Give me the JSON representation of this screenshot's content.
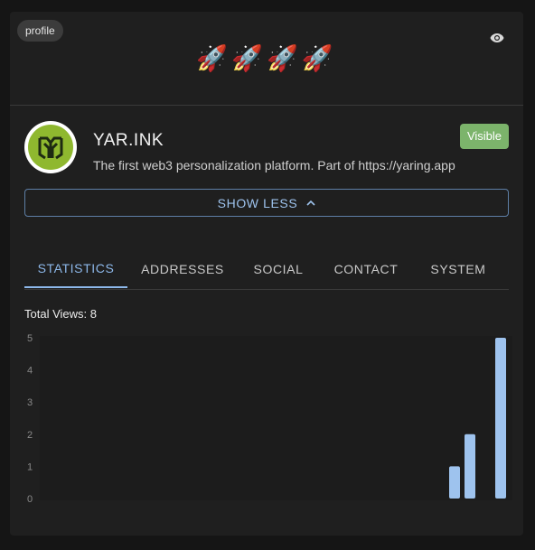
{
  "header": {
    "chip_label": "profile",
    "rockets": "🚀🚀🚀🚀",
    "eye_icon": "eye-icon"
  },
  "profile": {
    "name": "YAR.INK",
    "description": "The first web3 personalization platform. Part of https://yaring.app",
    "visibility_badge": "Visible",
    "badge_color": "#7cb46b",
    "avatar_color": "#8fb82f"
  },
  "show_less_button": {
    "label": "SHOW LESS",
    "icon": "chevron-up-icon"
  },
  "tabs": [
    {
      "label": "STATISTICS",
      "active": true
    },
    {
      "label": "ADDRESSES",
      "active": false
    },
    {
      "label": "SOCIAL",
      "active": false
    },
    {
      "label": "CONTACT",
      "active": false
    },
    {
      "label": "SYSTEM",
      "active": false
    }
  ],
  "stats": {
    "total_views_text": "Total Views: 8"
  },
  "chart_data": {
    "type": "bar",
    "title": "",
    "xlabel": "",
    "ylabel": "",
    "ylim": [
      0,
      5
    ],
    "yticks": [
      "0",
      "1",
      "2",
      "3",
      "4",
      "5"
    ],
    "values": [
      1,
      2,
      5
    ],
    "bar_color": "#9ec3ee",
    "grid": false
  },
  "accent_color": "#8db8ea"
}
